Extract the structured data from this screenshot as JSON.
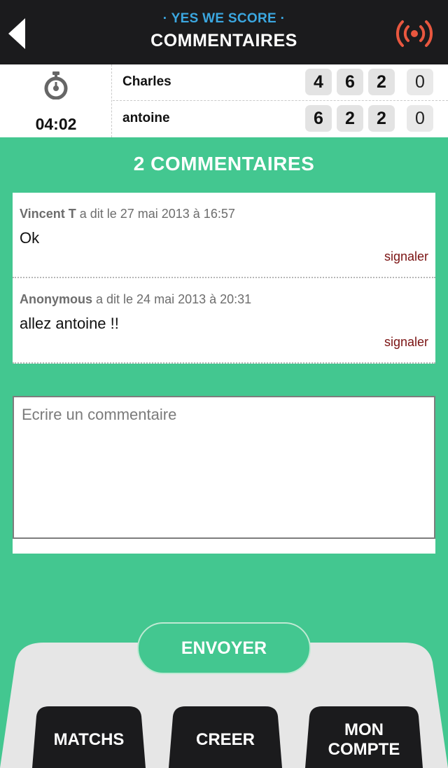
{
  "header": {
    "brand": "· YES WE SCORE ·",
    "title": "COMMENTAIRES",
    "back_icon": "back-arrow-icon",
    "live_icon": "broadcast-icon",
    "accent_color": "#e9573f"
  },
  "match": {
    "timer_icon": "stopwatch-icon",
    "time": "04:02",
    "players": [
      {
        "name": "Charles",
        "sets": [
          "4",
          "6",
          "2"
        ],
        "points": "0"
      },
      {
        "name": "antoine",
        "sets": [
          "6",
          "2",
          "2"
        ],
        "points": "0"
      }
    ]
  },
  "comments_section": {
    "count_label": "2 COMMENTAIRES",
    "items": [
      {
        "author": "Vincent T",
        "meta": " a dit le 27 mai 2013 à 16:57",
        "text": "Ok",
        "report_label": "signaler"
      },
      {
        "author": "Anonymous",
        "meta": " a dit le 24 mai 2013 à 20:31",
        "text": "allez antoine !!",
        "report_label": "signaler"
      }
    ]
  },
  "compose": {
    "placeholder": "Ecrire un commentaire",
    "value": ""
  },
  "actions": {
    "send_label": "ENVOYER"
  },
  "nav": {
    "matchs": "MATCHS",
    "creer": "CREER",
    "compte_line1": "MON",
    "compte_line2": "COMPTE"
  },
  "colors": {
    "background": "#43c790",
    "header": "#1b1b1d",
    "brand": "#3ba7e0",
    "report": "#7a1212",
    "tray": "#e6e6e6"
  }
}
